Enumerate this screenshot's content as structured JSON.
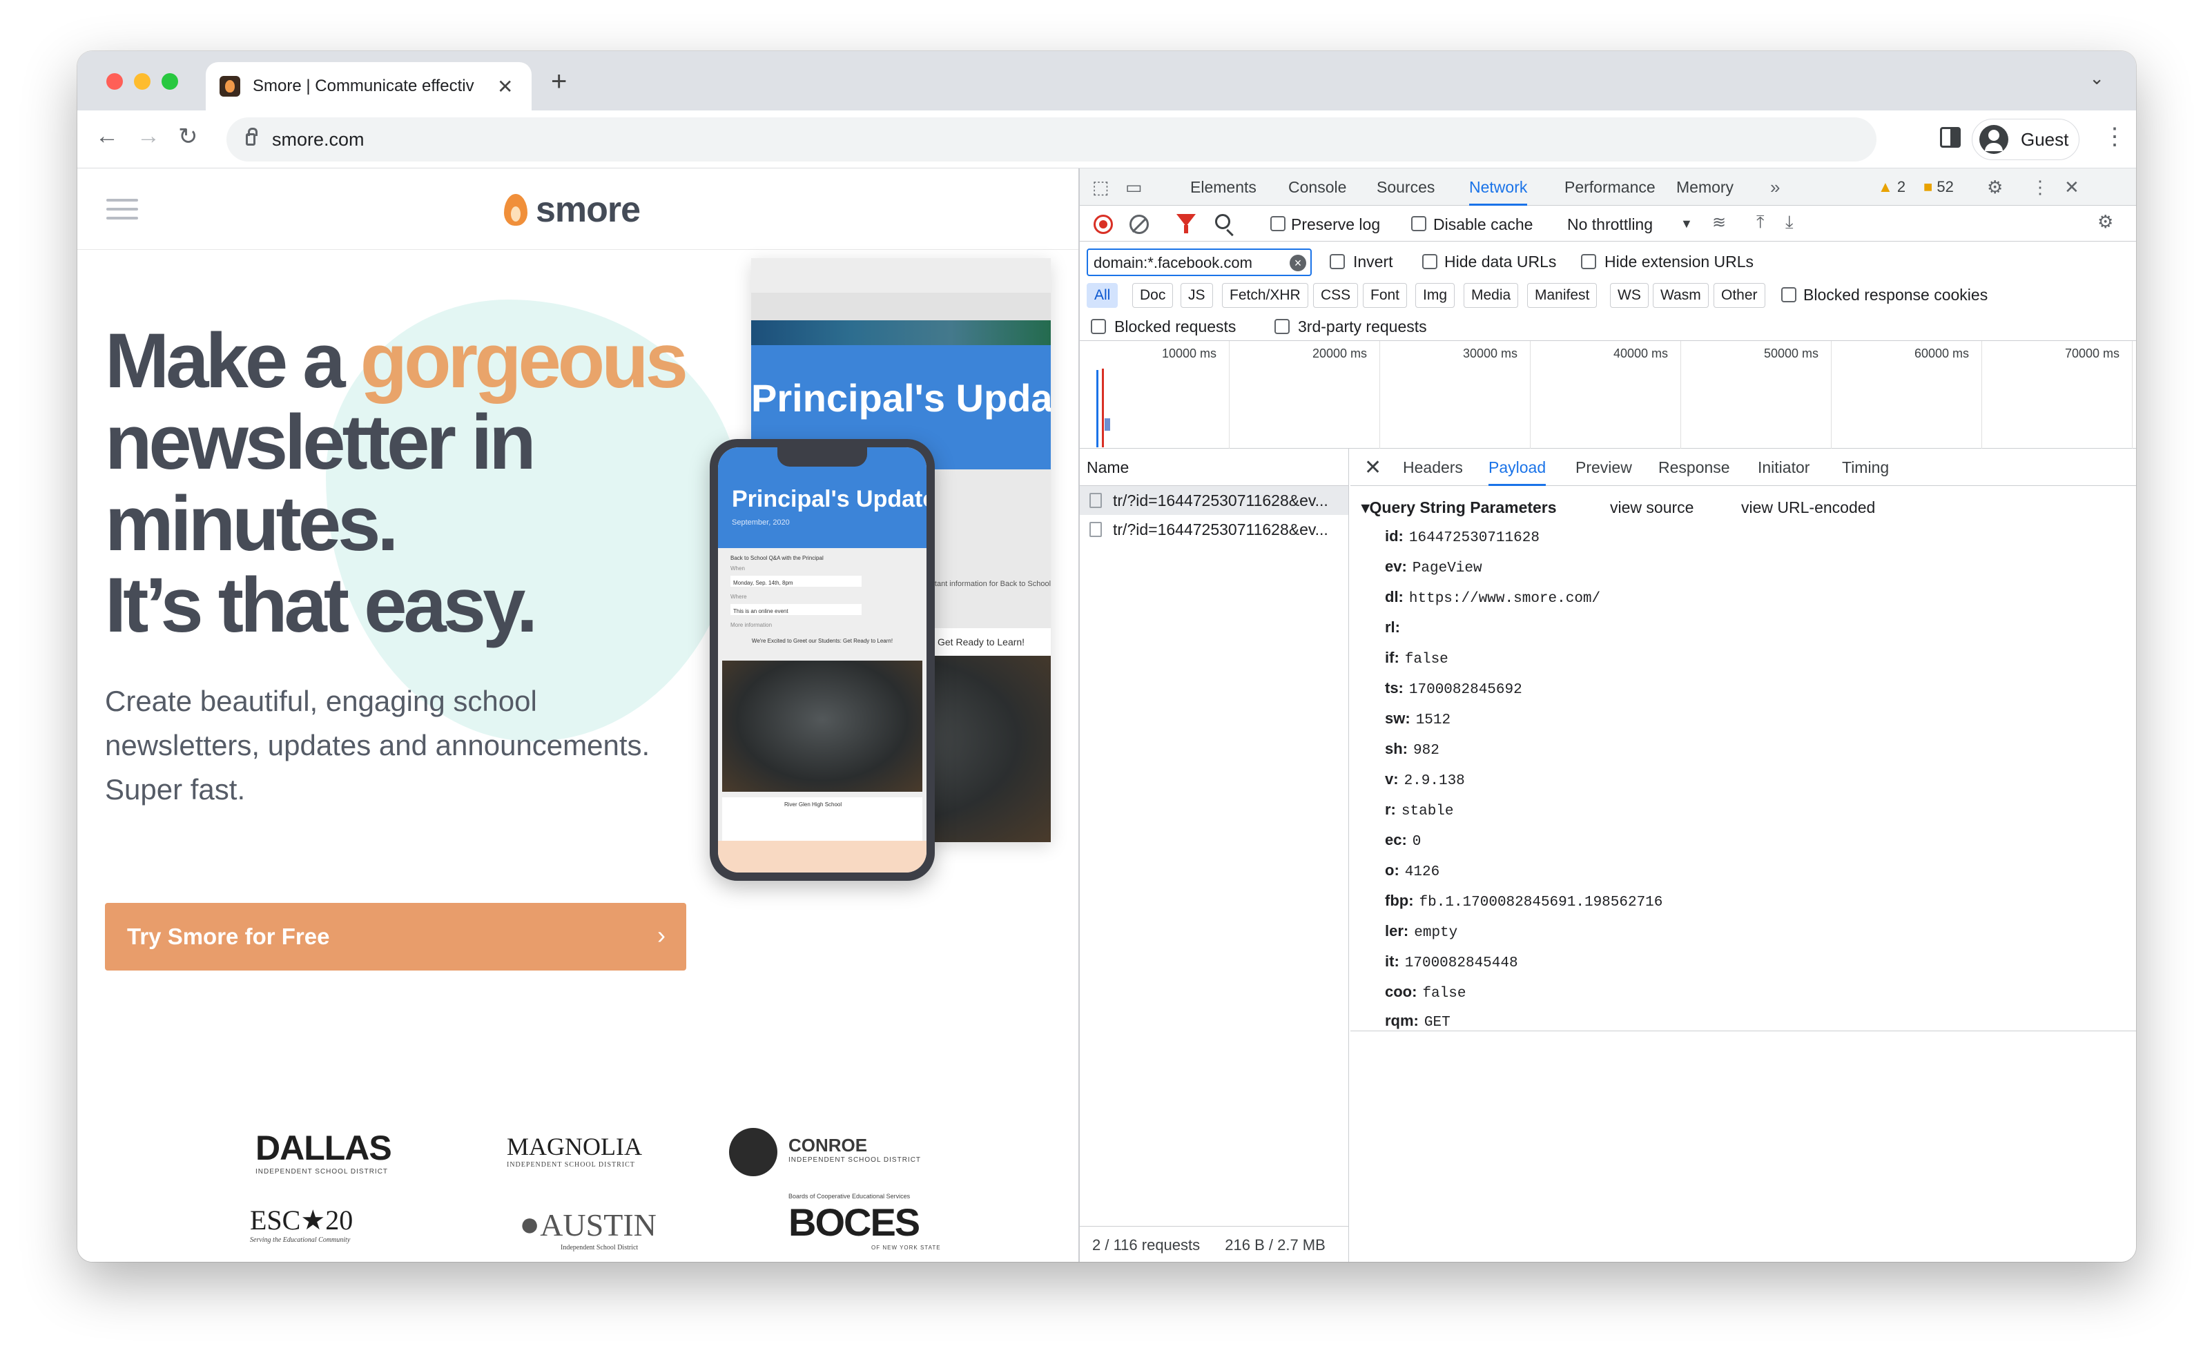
{
  "browser": {
    "tab_title": "Smore | Communicate effectiv",
    "url": "smore.com",
    "profile_name": "Guest"
  },
  "site": {
    "logo_text": "smore",
    "hero": {
      "line1_pre": "Make a ",
      "line1_accent": "gorgeous",
      "line2": "newsletter in",
      "line3": "minutes.",
      "line4": "It’s that easy."
    },
    "subtitle_line1": "Create beautiful, engaging school",
    "subtitle_line2": "newsletters, updates and announcements.",
    "subtitle_line3": "Super fast.",
    "cta_label": "Try Smore for Free",
    "mock": {
      "title": "Principal's Update",
      "date": "September, 2020",
      "qa_heading": "Back to School Q&A with the Principal",
      "when_label": "When",
      "when_value": "Monday, Sep. 14th, 8pm",
      "where_label": "Where",
      "where_value": "This is an online event",
      "more_info": "More information",
      "excited": "We're Excited to Greet our Students: Get Ready to Learn!",
      "back_excited": "Get Ready to Learn!",
      "back_info": "portant information for Back to School",
      "school_name": "River Glen High School"
    },
    "org_logos": {
      "dallas": "DALLAS",
      "dallas_sub": "INDEPENDENT SCHOOL DISTRICT",
      "magnolia": "MAGNOLIA",
      "magnolia_sub": "INDEPENDENT SCHOOL DISTRICT",
      "conroe": "CONROE",
      "conroe_sub": "INDEPENDENT SCHOOL DISTRICT",
      "esc": "ESC★20",
      "esc_sub": "Serving the Educational Community",
      "austin": "AUSTIN",
      "austin_sub": "Independent School District",
      "boces": "BOCES",
      "boces_top": "Boards of Cooperative Educational Services",
      "boces_sub": "OF NEW YORK STATE"
    }
  },
  "devtools": {
    "tabs": [
      "Elements",
      "Console",
      "Sources",
      "Network",
      "Performance",
      "Memory"
    ],
    "active_tab": "Network",
    "warnings": "2",
    "issues": "52",
    "toolbar": {
      "preserve_log": "Preserve log",
      "disable_cache": "Disable cache",
      "throttling": "No throttling"
    },
    "filter": {
      "value": "domain:*.facebook.com",
      "invert": "Invert",
      "hide_data_urls": "Hide data URLs",
      "hide_extension_urls": "Hide extension URLs",
      "types": [
        "All",
        "Doc",
        "JS",
        "Fetch/XHR",
        "CSS",
        "Font",
        "Img",
        "Media",
        "Manifest",
        "WS",
        "Wasm",
        "Other"
      ],
      "blocked_response_cookies": "Blocked response cookies",
      "blocked_requests": "Blocked requests",
      "third_party_requests": "3rd-party requests"
    },
    "timeline_labels": [
      "10000 ms",
      "20000 ms",
      "30000 ms",
      "40000 ms",
      "50000 ms",
      "60000 ms",
      "70000 ms"
    ],
    "name_header": "Name",
    "requests": [
      "tr/?id=164472530711628&ev...",
      "tr/?id=164472530711628&ev..."
    ],
    "status": {
      "requests": "2 / 116 requests",
      "transferred": "216 B / 2.7 MB"
    },
    "detail_tabs": [
      "Headers",
      "Payload",
      "Preview",
      "Response",
      "Initiator",
      "Timing"
    ],
    "active_detail_tab": "Payload",
    "payload": {
      "section_title": "Query String Parameters",
      "view_source": "view source",
      "view_url_encoded": "view URL-encoded",
      "params": [
        {
          "key": "id:",
          "value": "164472530711628"
        },
        {
          "key": "ev:",
          "value": "PageView"
        },
        {
          "key": "dl:",
          "value": "https://www.smore.com/"
        },
        {
          "key": "rl:",
          "value": ""
        },
        {
          "key": "if:",
          "value": "false"
        },
        {
          "key": "ts:",
          "value": "1700082845692"
        },
        {
          "key": "sw:",
          "value": "1512"
        },
        {
          "key": "sh:",
          "value": "982"
        },
        {
          "key": "v:",
          "value": "2.9.138"
        },
        {
          "key": "r:",
          "value": "stable"
        },
        {
          "key": "ec:",
          "value": "0"
        },
        {
          "key": "o:",
          "value": "4126"
        },
        {
          "key": "fbp:",
          "value": "fb.1.1700082845691.198562716"
        },
        {
          "key": "ler:",
          "value": "empty"
        },
        {
          "key": "it:",
          "value": "1700082845448"
        },
        {
          "key": "coo:",
          "value": "false"
        },
        {
          "key": "rqm:",
          "value": "GET"
        }
      ]
    }
  }
}
